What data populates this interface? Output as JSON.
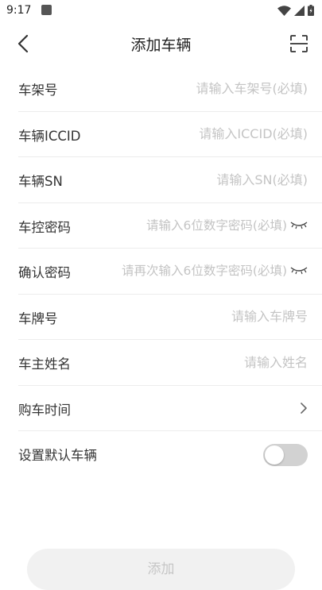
{
  "status": {
    "time": "9:17"
  },
  "header": {
    "title": "添加车辆"
  },
  "form": {
    "frame_no": {
      "label": "车架号",
      "placeholder": "请输入车架号(必填)"
    },
    "iccid": {
      "label": "车辆ICCID",
      "placeholder": "请输入ICCID(必填)"
    },
    "sn": {
      "label": "车辆SN",
      "placeholder": "请输入SN(必填)"
    },
    "password": {
      "label": "车控密码",
      "placeholder": "请输入6位数字密码(必填)"
    },
    "confirm_password": {
      "label": "确认密码",
      "placeholder": "请再次输入6位数字密码(必填)"
    },
    "plate": {
      "label": "车牌号",
      "placeholder": "请输入车牌号"
    },
    "owner": {
      "label": "车主姓名",
      "placeholder": "请输入姓名"
    },
    "purchase_time": {
      "label": "购车时间"
    },
    "default_vehicle": {
      "label": "设置默认车辆",
      "enabled": false
    }
  },
  "actions": {
    "add_label": "添加"
  },
  "colors": {
    "placeholder": "#c4c4c4",
    "divider": "#ececec",
    "toggle_off": "#d2d2d2"
  }
}
